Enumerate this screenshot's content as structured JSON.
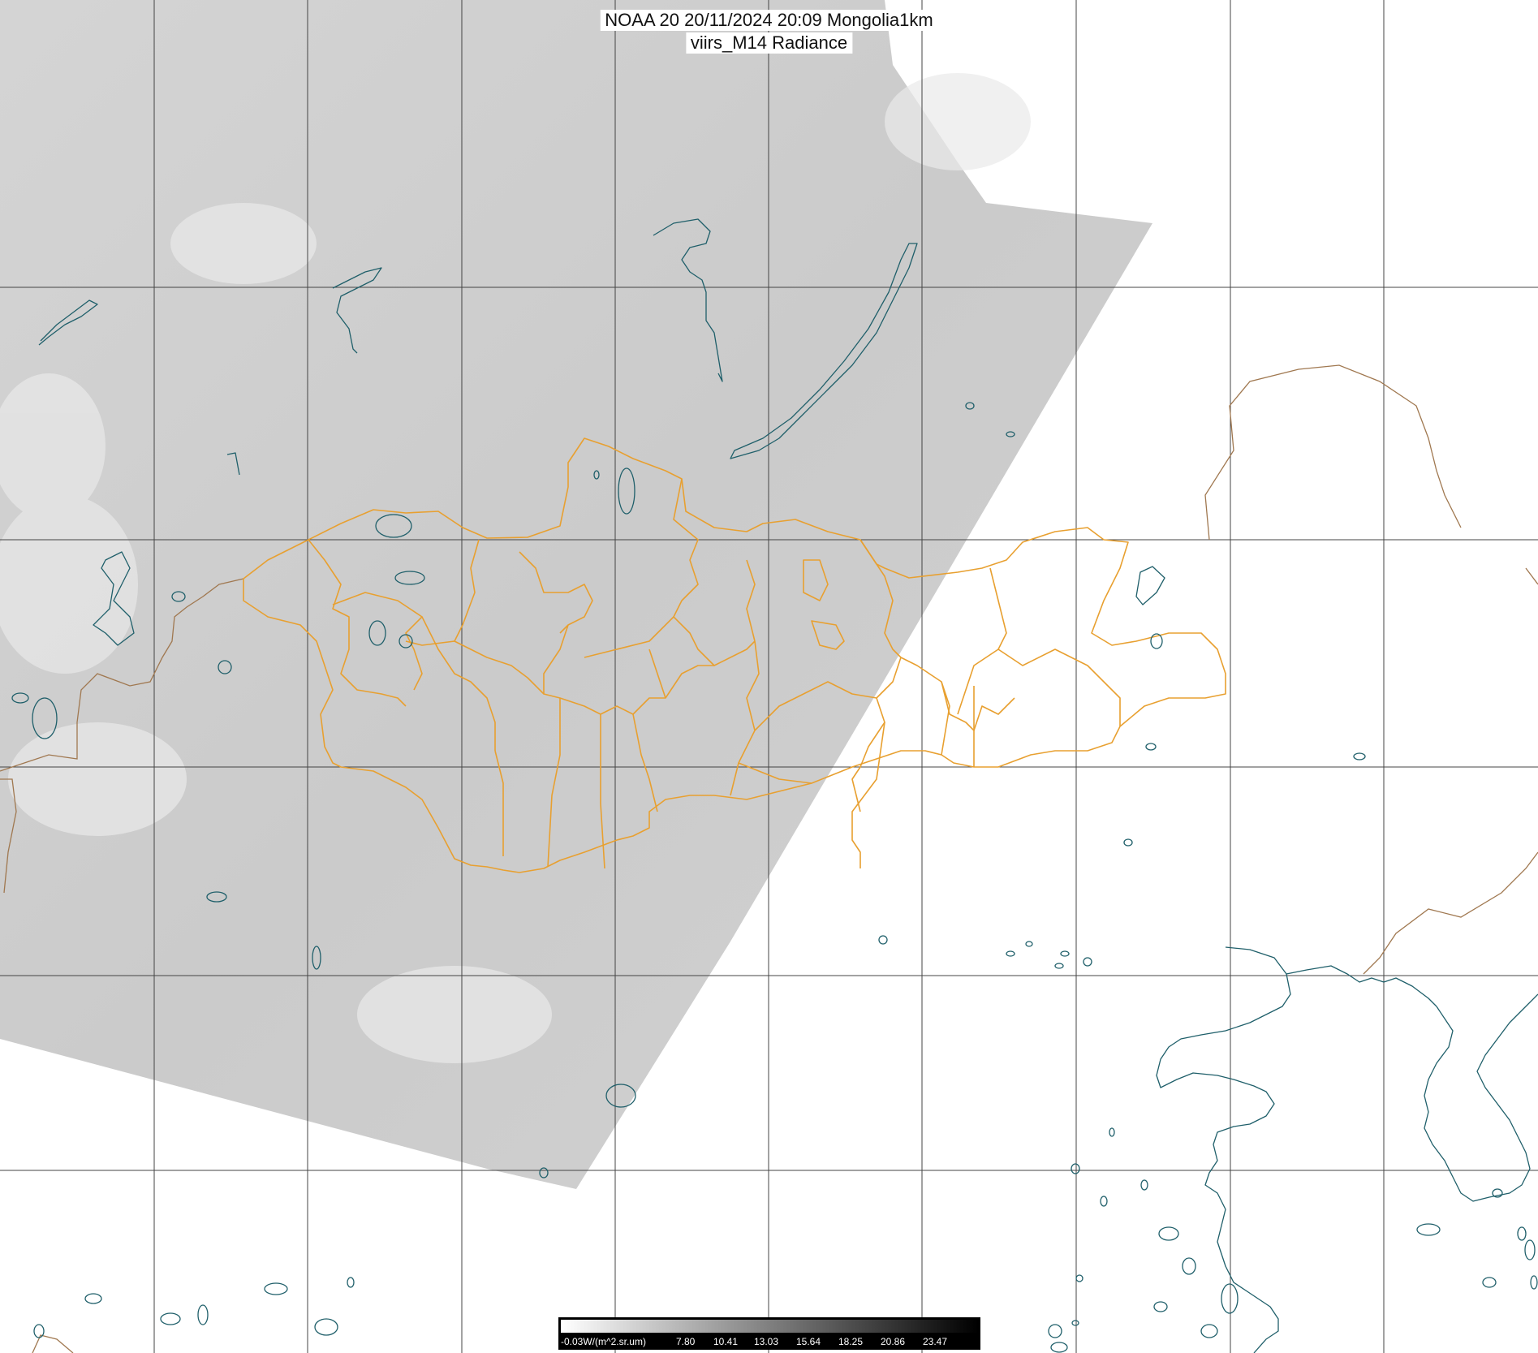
{
  "title": {
    "line1": "NOAA 20 20/11/2024 20:09 Mongolia1km",
    "line2": "viirs_M14 Radiance"
  },
  "colorbar": {
    "unit_label": "-0.03W/(m^2.sr.um)",
    "ticks": [
      "7.80",
      "10.41",
      "13.03",
      "15.64",
      "18.25",
      "20.86",
      "23.47"
    ],
    "gradient_start": "#ffffff",
    "gradient_end": "#000000"
  },
  "colors": {
    "province_borders": "#e8a030",
    "country_borders": "#a07850",
    "coastlines_lakes": "#1f5f6a",
    "graticule": "#444444",
    "satellite_swath": "#d6d6d6"
  }
}
